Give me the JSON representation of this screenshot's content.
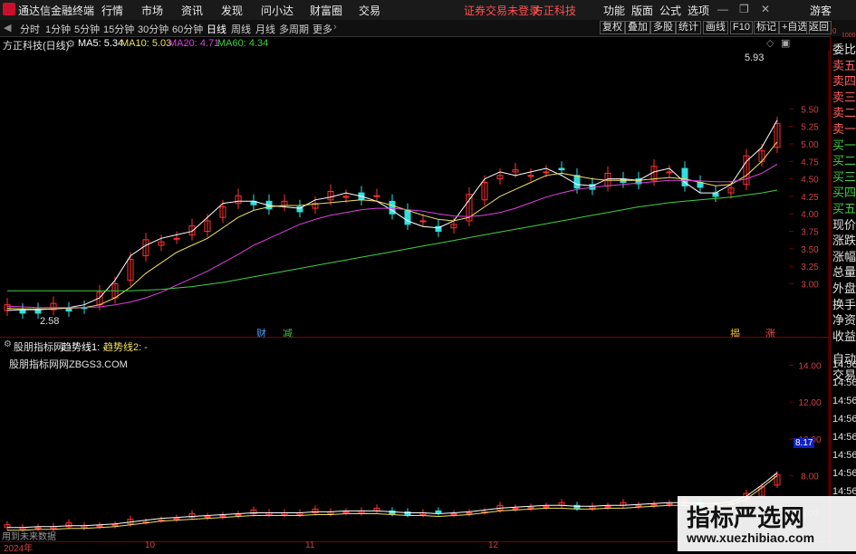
{
  "app": {
    "title": "通达信金融终端",
    "menu": [
      "行情",
      "市场",
      "资讯",
      "发现",
      "问小达",
      "财富圈",
      "交易"
    ],
    "notice": "证券交易未登录",
    "broker": "方正科技",
    "right_menu": [
      "功能",
      "版面",
      "公式",
      "选项"
    ],
    "guest": "游客"
  },
  "toolbar": {
    "periods": [
      "分时",
      "1分钟",
      "5分钟",
      "15分钟",
      "30分钟",
      "60分钟",
      "日线",
      "周线",
      "月线",
      "多周期",
      "更多"
    ],
    "active_period": "日线",
    "right_buttons": [
      "复权",
      "叠加",
      "多股",
      "统计",
      "画线",
      "F10",
      "标记",
      "+自选",
      "返回"
    ]
  },
  "main_chart": {
    "stock_label": "方正科技(日线)",
    "ma_labels": [
      {
        "text": "MA5: 5.34",
        "color": "#ffffff"
      },
      {
        "text": "MA10: 5.03",
        "color": "#f0e060"
      },
      {
        "text": "MA20: 4.71",
        "color": "#e040e0"
      },
      {
        "text": "MA60: 4.34",
        "color": "#40d040"
      }
    ],
    "high_label": "5.93",
    "low_label": "2.58",
    "event_labels": [
      {
        "text": "财",
        "color": "#4aa0ff"
      },
      {
        "text": "减",
        "color": "#40c040"
      },
      {
        "text": "揭",
        "color": "#f0c040"
      },
      {
        "text": "涨",
        "color": "#ff5050"
      }
    ]
  },
  "sub_chart": {
    "indicator_name": "股朋指标网",
    "line1": "趋势线1: -",
    "line2": "趋势线2: -",
    "watermark_text": "股朋指标网网ZBGS3.COM",
    "current_value": "8.17",
    "bottom_left": "用到未来数据"
  },
  "right_panel": {
    "items": [
      "委比",
      "卖五",
      "卖四",
      "卖三",
      "卖二",
      "卖一",
      "买一",
      "买二",
      "买三",
      "买四",
      "买五",
      "现价",
      "涨跌",
      "涨幅",
      "总量",
      "外盘",
      "换手",
      "净资",
      "收益",
      "自动",
      "交易",
      "14:56",
      "14:56",
      "14:56",
      "14:56",
      "14:56",
      "14:56",
      "14:56",
      "14:56"
    ],
    "top_marks": [
      "0",
      "1000"
    ]
  },
  "x_axis": [
    "2024年",
    "10",
    "11",
    "12"
  ],
  "brand": {
    "big": "指标严选网",
    "url": "www.xuezhibiao.com"
  },
  "chart_data": [
    {
      "type": "line",
      "title": "方正科技(日线)",
      "ylim": [
        2.58,
        5.93
      ],
      "y_ticks": [
        5.5,
        5.25,
        5.0,
        4.75,
        4.5,
        4.25,
        4.0,
        3.75,
        3.5,
        3.25,
        3.0
      ],
      "series": [
        {
          "name": "MA5",
          "last": 5.34,
          "color": "#ffffff",
          "values": [
            2.62,
            2.63,
            2.63,
            2.64,
            2.66,
            2.7,
            2.8,
            3.05,
            3.4,
            3.55,
            3.65,
            3.7,
            3.75,
            3.95,
            4.15,
            4.18,
            4.18,
            4.12,
            4.1,
            4.08,
            4.2,
            4.24,
            4.3,
            4.25,
            4.18,
            4.05,
            3.9,
            3.82,
            3.8,
            3.9,
            4.2,
            4.5,
            4.6,
            4.55,
            4.6,
            4.65,
            4.55,
            4.42,
            4.4,
            4.5,
            4.5,
            4.48,
            4.6,
            4.65,
            4.45,
            4.3,
            4.3,
            4.42,
            4.75,
            4.95,
            5.34
          ]
        },
        {
          "name": "MA10",
          "last": 5.03,
          "color": "#f0e060",
          "values": [
            2.65,
            2.64,
            2.64,
            2.64,
            2.65,
            2.66,
            2.7,
            2.8,
            2.95,
            3.15,
            3.3,
            3.45,
            3.55,
            3.65,
            3.8,
            3.95,
            4.05,
            4.1,
            4.12,
            4.12,
            4.14,
            4.16,
            4.18,
            4.2,
            4.18,
            4.12,
            4.05,
            3.98,
            3.92,
            3.9,
            3.95,
            4.1,
            4.25,
            4.35,
            4.45,
            4.55,
            4.58,
            4.54,
            4.5,
            4.48,
            4.48,
            4.48,
            4.5,
            4.52,
            4.5,
            4.45,
            4.4,
            4.42,
            4.55,
            4.75,
            5.03
          ]
        },
        {
          "name": "MA20",
          "last": 4.71,
          "color": "#e040e0",
          "values": [
            2.68,
            2.67,
            2.66,
            2.66,
            2.66,
            2.66,
            2.67,
            2.7,
            2.74,
            2.8,
            2.88,
            2.98,
            3.08,
            3.18,
            3.3,
            3.42,
            3.55,
            3.65,
            3.75,
            3.85,
            3.92,
            3.98,
            4.02,
            4.06,
            4.08,
            4.08,
            4.06,
            4.04,
            4.0,
            3.97,
            3.96,
            3.98,
            4.02,
            4.08,
            4.16,
            4.24,
            4.3,
            4.35,
            4.38,
            4.4,
            4.42,
            4.44,
            4.46,
            4.48,
            4.48,
            4.47,
            4.46,
            4.46,
            4.5,
            4.58,
            4.71
          ]
        },
        {
          "name": "MA60",
          "last": 4.34,
          "color": "#40d040",
          "values": [
            2.9,
            2.9,
            2.9,
            2.9,
            2.9,
            2.9,
            2.9,
            2.9,
            2.9,
            2.91,
            2.92,
            2.94,
            2.96,
            2.99,
            3.02,
            3.06,
            3.1,
            3.14,
            3.18,
            3.22,
            3.26,
            3.3,
            3.34,
            3.38,
            3.42,
            3.46,
            3.5,
            3.54,
            3.58,
            3.62,
            3.66,
            3.7,
            3.74,
            3.78,
            3.82,
            3.86,
            3.9,
            3.94,
            3.98,
            4.02,
            4.06,
            4.1,
            4.13,
            4.16,
            4.18,
            4.2,
            4.22,
            4.24,
            4.27,
            4.3,
            4.34
          ]
        }
      ]
    },
    {
      "type": "bar",
      "title": "股朋指标网",
      "ylim": [
        5.0,
        15.0
      ],
      "y_ticks": [
        14.0,
        12.0,
        10.0,
        8.0,
        6.0
      ],
      "series": [
        {
          "name": "趋势线1",
          "values": [
            5.2,
            5.2,
            5.25,
            5.25,
            5.3,
            5.3,
            5.35,
            5.4,
            5.5,
            5.6,
            5.7,
            5.75,
            5.8,
            5.85,
            5.9,
            5.95,
            6.0,
            6.0,
            6.0,
            6.0,
            6.05,
            6.05,
            6.1,
            6.1,
            6.1,
            6.05,
            6.0,
            6.0,
            5.95,
            6.0,
            6.05,
            6.15,
            6.25,
            6.3,
            6.35,
            6.4,
            6.4,
            6.35,
            6.35,
            6.4,
            6.4,
            6.45,
            6.5,
            6.55,
            6.55,
            6.5,
            6.5,
            6.6,
            6.9,
            7.5,
            8.17
          ]
        }
      ]
    }
  ]
}
